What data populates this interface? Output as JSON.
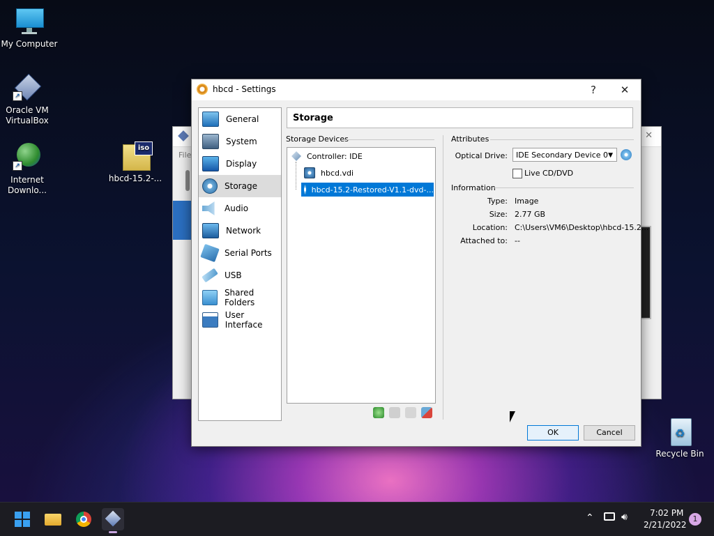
{
  "desktop": {
    "icons": [
      {
        "label": "My Computer"
      },
      {
        "label": "Oracle VM VirtualBox"
      },
      {
        "label": "Internet Downlo..."
      },
      {
        "label": "hbcd-15.2-..."
      },
      {
        "label": "Recycle Bin"
      }
    ]
  },
  "background_window": {
    "menu_label": "File"
  },
  "dialog": {
    "title": "hbcd - Settings",
    "help_label": "?",
    "close_label": "✕",
    "nav": [
      {
        "label": "General",
        "icon": "general-icon"
      },
      {
        "label": "System",
        "icon": "system-icon"
      },
      {
        "label": "Display",
        "icon": "display-icon"
      },
      {
        "label": "Storage",
        "icon": "storage-icon"
      },
      {
        "label": "Audio",
        "icon": "audio-icon"
      },
      {
        "label": "Network",
        "icon": "network-icon"
      },
      {
        "label": "Serial Ports",
        "icon": "serial-ports-icon"
      },
      {
        "label": "USB",
        "icon": "usb-icon"
      },
      {
        "label": "Shared Folders",
        "icon": "shared-folders-icon"
      },
      {
        "label": "User Interface",
        "icon": "user-interface-icon"
      }
    ],
    "selected_nav": "Storage",
    "section_title": "Storage",
    "storage_devices_label": "Storage Devices",
    "tree": {
      "controller": "Controller: IDE",
      "disk": "hbcd.vdi",
      "optical": "hbcd-15.2-Restored-V1.1-dvd-..."
    },
    "attributes_label": "Attributes",
    "optical_drive_label": "Optical Drive:",
    "optical_drive_value": "IDE Secondary Device 0",
    "live_cd_label": "Live CD/DVD",
    "information_label": "Information",
    "info": {
      "type_key": "Type:",
      "type_val": "Image",
      "size_key": "Size:",
      "size_val": "2.77 GB",
      "location_key": "Location:",
      "location_val": "C:\\Users\\VM6\\Desktop\\hbcd-15.2...",
      "attached_key": "Attached to:",
      "attached_val": "--"
    },
    "ok_label": "OK",
    "cancel_label": "Cancel"
  },
  "taskbar": {
    "time": "7:02 PM",
    "date": "2/21/2022",
    "notification_count": "1",
    "chevron": "^"
  },
  "colors": {
    "accent": "#0078d7",
    "selection_bg": "#dcdcdc"
  }
}
